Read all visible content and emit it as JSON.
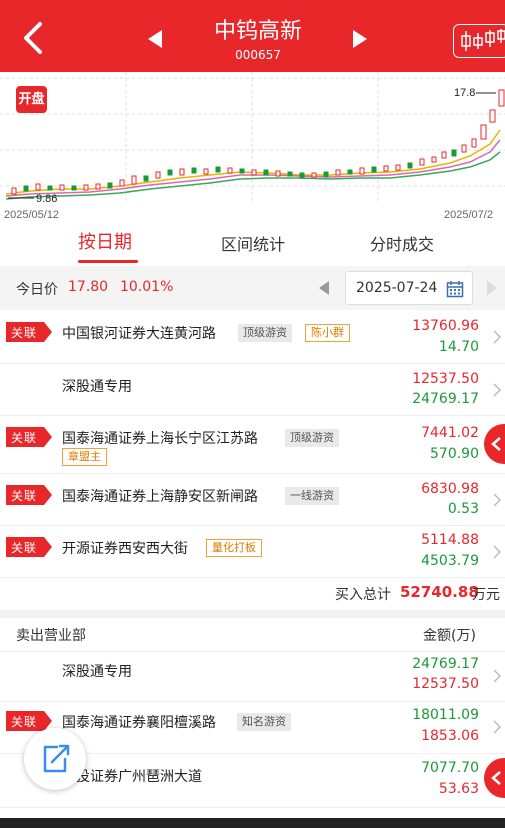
{
  "header": {
    "title": "中钨高新",
    "code": "000657"
  },
  "chart": {
    "open_badge": "开盘",
    "high_label": "17.8",
    "low_label": "9.86",
    "start_date": "2025/05/12",
    "end_date": "2025/07/2"
  },
  "tabs": [
    {
      "label": "按日期",
      "active": true
    },
    {
      "label": "区间统计",
      "active": false
    },
    {
      "label": "分时成交",
      "active": false
    }
  ],
  "price_row": {
    "label": "今日价",
    "price": "17.80",
    "change_pct": "10.01%",
    "date": "2025-07-24"
  },
  "buy_rows": [
    {
      "tag": "关联",
      "name": "中国银河证券大连黄河路",
      "badge1": "顶级游资",
      "badge2": "陈小群",
      "v1": "13760.96",
      "v2": "14.70"
    },
    {
      "tag": "",
      "name": "深股通专用",
      "badge1": "",
      "badge2": "",
      "v1": "12537.50",
      "v2": "24769.17"
    },
    {
      "tag": "关联",
      "name": "国泰海通证券上海长宁区江苏路",
      "badge1": "顶级游资",
      "badge2": "章盟主",
      "v1": "7441.02",
      "v2": "570.90"
    },
    {
      "tag": "关联",
      "name": "国泰海通证券上海静安区新闸路",
      "badge1": "一线游资",
      "badge2": "",
      "v1": "6830.98",
      "v2": "0.53"
    },
    {
      "tag": "关联",
      "name": "开源证券西安西大街",
      "badge1": "",
      "badge2": "量化打板",
      "v1": "5114.88",
      "v2": "4503.79"
    }
  ],
  "buy_total": {
    "label": "买入总计",
    "value": "52740.88",
    "unit": "万元"
  },
  "sell_header": {
    "title": "卖出营业部",
    "amount": "金额(万)"
  },
  "sell_rows": [
    {
      "tag": "",
      "name": "深股通专用",
      "badge1": "",
      "v1": "24769.17",
      "v2": "12537.50"
    },
    {
      "tag": "关联",
      "name": "国泰海通证券襄阳檀溪路",
      "badge1": "知名游资",
      "v1": "18011.09",
      "v2": "1853.06"
    },
    {
      "tag": "",
      "name": "国投证券广州琶洲大道",
      "badge1": "",
      "v1": "7077.70",
      "v2": "53.63"
    }
  ],
  "colors": {
    "brand_red": "#e8272b",
    "buy_green": "#1a9a36"
  },
  "icons": [
    "back-icon",
    "prev-stock-icon",
    "next-stock-icon",
    "kline-icon",
    "calendar-icon",
    "chevron-right-icon",
    "share-icon",
    "side-collapse-icon"
  ]
}
